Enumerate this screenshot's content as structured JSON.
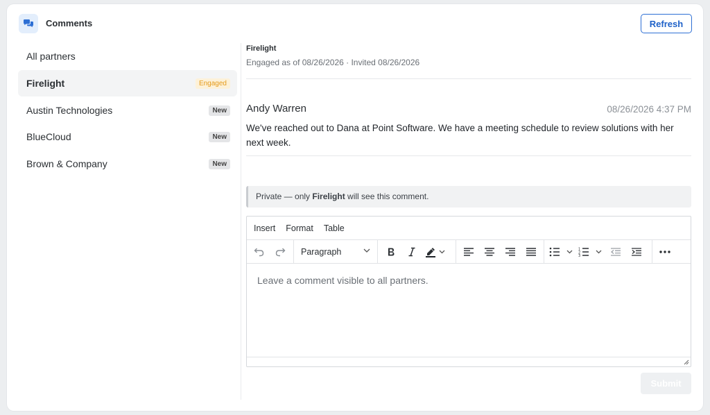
{
  "header": {
    "title": "Comments",
    "refresh_label": "Refresh"
  },
  "sidebar": {
    "items": [
      {
        "label": "All partners",
        "badge": ""
      },
      {
        "label": "Firelight",
        "badge": "Engaged"
      },
      {
        "label": "Austin Technologies",
        "badge": "New"
      },
      {
        "label": "BlueCloud",
        "badge": "New"
      },
      {
        "label": "Brown & Company",
        "badge": "New"
      }
    ]
  },
  "partner": {
    "name": "Firelight",
    "status": "Engaged as of 08/26/2026 · Invited 08/26/2026"
  },
  "comment": {
    "author": "Andy Warren",
    "timestamp": "08/26/2026 4:37 PM",
    "body": "We've reached out to Dana at Point Software. We have a meeting schedule to review solutions with her next week."
  },
  "private_note": {
    "prefix": "Private — only ",
    "partner": "Firelight",
    "suffix": " will see this comment."
  },
  "editor": {
    "menu": [
      "Insert",
      "Format",
      "Table"
    ],
    "block_format": "Paragraph",
    "placeholder": "Leave a comment visible to all partners.",
    "icons": [
      "undo-icon",
      "redo-icon",
      "bold-icon",
      "italic-icon",
      "highlight-icon",
      "align-left-icon",
      "align-center-icon",
      "align-right-icon",
      "align-justify-icon",
      "bullet-list-icon",
      "numbered-list-icon",
      "outdent-icon",
      "indent-icon",
      "more-icon"
    ]
  },
  "submit_label": "Submit",
  "colors": {
    "accent": "#2d6fd4",
    "engaged_text": "#e49a1a",
    "engaged_bg": "#fdf1d8"
  }
}
